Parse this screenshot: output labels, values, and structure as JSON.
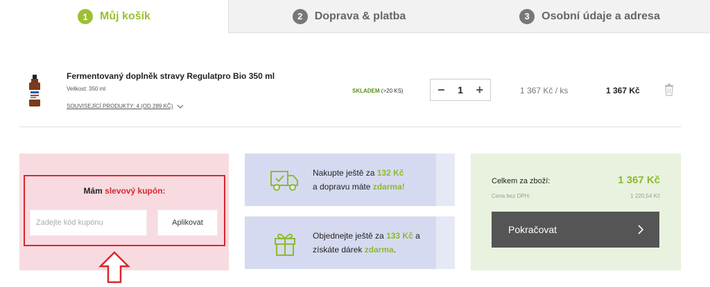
{
  "steps": [
    {
      "num": "1",
      "label": "Můj košík",
      "active": true
    },
    {
      "num": "2",
      "label": "Doprava & platba",
      "active": false
    },
    {
      "num": "3",
      "label": "Osobní údaje a adresa",
      "active": false
    }
  ],
  "product": {
    "title": "Fermentovaný doplněk stravy Regulatpro Bio 350 ml",
    "size": "Velikost: 350 ml",
    "related": "SOUVISEJÍCÍ PRODUKTY: 4 (OD 289 KČ)",
    "stock": "SKLADEM",
    "stock_count": "(>20 KS)",
    "quantity": "1",
    "minus": "−",
    "plus": "+",
    "unit_price": "1 367 Kč  / ks",
    "total_price": "1 367 Kč"
  },
  "coupon": {
    "title_prefix": "Mám ",
    "title_highlight": "slevový kupón:",
    "input_placeholder": "Zadejte kód kupónu",
    "apply_label": "Aplikovat"
  },
  "promo_shipping": {
    "line1_prefix": "Nakupte ještě za ",
    "line1_amount": "132 Kč",
    "line2_prefix": "a dopravu máte ",
    "line2_highlight": "zdarma!"
  },
  "promo_gift": {
    "line1_prefix": "Objednejte ještě za ",
    "line1_amount": "133 Kč",
    "line1_suffix": " a",
    "line2_prefix": "získáte dárek ",
    "line2_highlight": "zdarma",
    "line2_suffix": "."
  },
  "summary": {
    "total_label": "Celkem za zboží:",
    "total_value": "1 367 Kč",
    "net_label": "Cena bez DPH:",
    "net_value": "1 220,54 Kč",
    "continue_label": "Pokračovat"
  },
  "colors": {
    "accent_green": "#8cba2f",
    "coupon_red": "#d9262c",
    "button_dark": "#555555"
  },
  "icons": [
    "chevron-down-icon",
    "trash-icon",
    "delivery-truck-icon",
    "gift-icon",
    "chevron-right-icon",
    "up-arrow-icon"
  ]
}
